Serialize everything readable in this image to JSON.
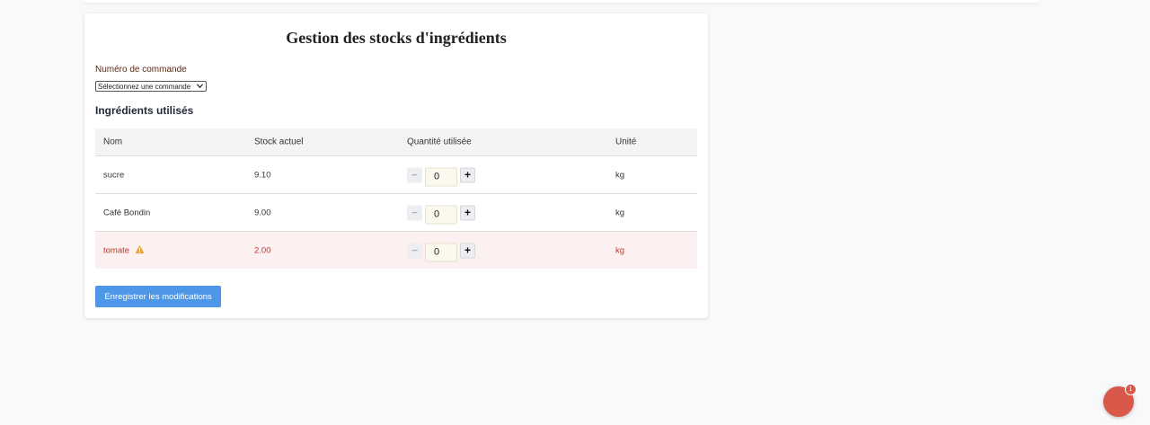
{
  "page": {
    "title": "Gestion des stocks d'ingrédients"
  },
  "order": {
    "label": "Numéro de commande",
    "selected": "Sélectionnez une commande"
  },
  "ingredients": {
    "section_title": "Ingrédients utilisés",
    "columns": [
      "Nom",
      "Stock actuel",
      "Quantité utilisée",
      "Unité"
    ],
    "rows": [
      {
        "name": "sucre",
        "stock": "9.10",
        "quantity": "0",
        "unit": "kg",
        "low_stock": false
      },
      {
        "name": "Café Bondin",
        "stock": "9.00",
        "quantity": "0",
        "unit": "kg",
        "low_stock": false
      },
      {
        "name": "tomate",
        "stock": "2.00",
        "quantity": "0",
        "unit": "kg",
        "low_stock": true
      }
    ],
    "minus_symbol": "−",
    "plus_symbol": "+"
  },
  "actions": {
    "save_label": "Enregistrer les modifications"
  },
  "notification": {
    "badge_count": "1"
  },
  "colors": {
    "primary": "#4e97e8",
    "warning_row": "#fdf0f0",
    "warning_text": "#b5392d",
    "warning_icon": "#e8a53a",
    "fab": "#d9584a"
  },
  "icons": {
    "warning": "warning-triangle-icon",
    "chevron": "chevron-down-icon"
  }
}
